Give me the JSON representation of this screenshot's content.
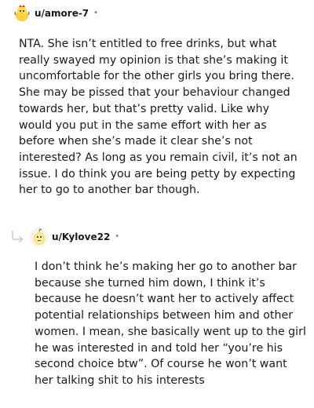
{
  "comments": [
    {
      "username": "u/amore-7",
      "separator": "•",
      "avatar_icon": "chick-snoo-avatar",
      "body": "NTA. She isn’t entitled to free drinks, but what really swayed my opinion is that she’s making it uncomfortable for the other girls you bring there. She may be pissed that your behaviour changed towards her, but that’s pretty valid. Like why would you put in the same effort with her as before when she’s made it clear she’s not interested? As long as you remain civil, it’s not an issue. I do think you are being petty by expecting her to go to another bar though."
    },
    {
      "username": "u/Kylove22",
      "separator": "•",
      "avatar_icon": "lemon-snoo-avatar",
      "reply_icon": "reply-arrow-icon",
      "body": "I don’t think he’s making her go to another bar because she turned him down, I think it’s because he doesn’t want her to actively affect potential relationships between him and other women. I mean, she basically went up to the girl he was interested in and told her “you’re his second choice btw”. Of course he won’t want her talking shit to his interests"
    }
  ],
  "colors": {
    "text": "#1a1a1b",
    "meta": "#7c7c7c",
    "reply_arrow": "#c9c9c9"
  }
}
